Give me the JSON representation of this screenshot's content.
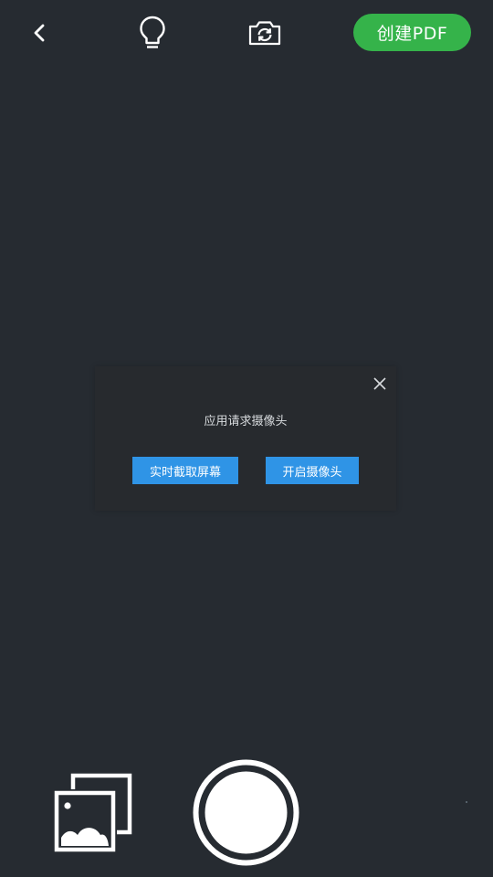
{
  "toolbar": {
    "back_icon": "chevron-left-icon",
    "flash_icon": "lightbulb-icon",
    "switch_camera_icon": "camera-switch-icon",
    "create_pdf_label": "创建PDF"
  },
  "dialog": {
    "title": "应用请求摄像头",
    "close_icon": "close-icon",
    "capture_screen_label": "实时截取屏幕",
    "open_camera_label": "开启摄像头"
  },
  "bottom": {
    "gallery_icon": "gallery-icon",
    "shutter_icon": "shutter-icon"
  },
  "colors": {
    "background": "#262b31",
    "dialog_background": "#272a2e",
    "accent_green": "#35b34a",
    "dialog_button": "#2f94e6",
    "icon": "#ffffff"
  }
}
